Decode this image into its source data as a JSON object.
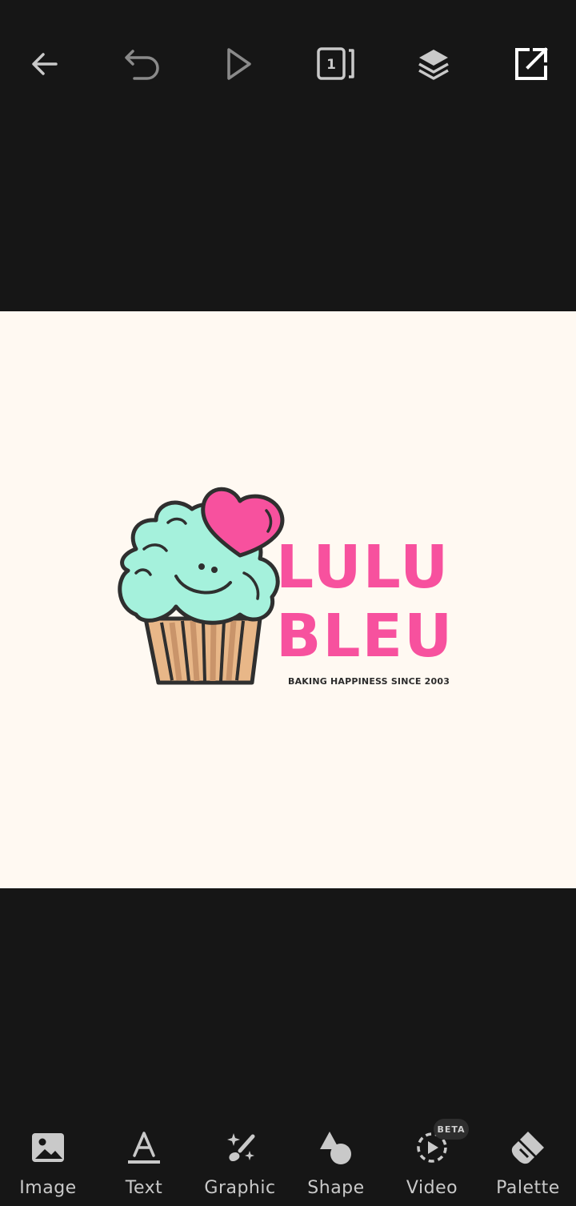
{
  "top_bar": {
    "page_count": "1",
    "icons": [
      "back-arrow-icon",
      "undo-icon",
      "play-icon",
      "pages-icon",
      "layers-icon",
      "share-icon"
    ]
  },
  "canvas": {
    "background": "#fff9f2",
    "brand_line_1": "LULU",
    "brand_line_2": "BLEU",
    "tagline": "BAKING HAPPINESS SINCE 2003",
    "brand_color": "#f7519e"
  },
  "bottom_bar": {
    "items": [
      {
        "label": "Image",
        "icon": "image-icon"
      },
      {
        "label": "Text",
        "icon": "text-icon"
      },
      {
        "label": "Graphic",
        "icon": "graphic-icon"
      },
      {
        "label": "Shape",
        "icon": "shape-icon"
      },
      {
        "label": "Video",
        "icon": "video-icon"
      },
      {
        "label": "Palette",
        "icon": "palette-icon"
      }
    ],
    "video_badge": "BETA"
  }
}
